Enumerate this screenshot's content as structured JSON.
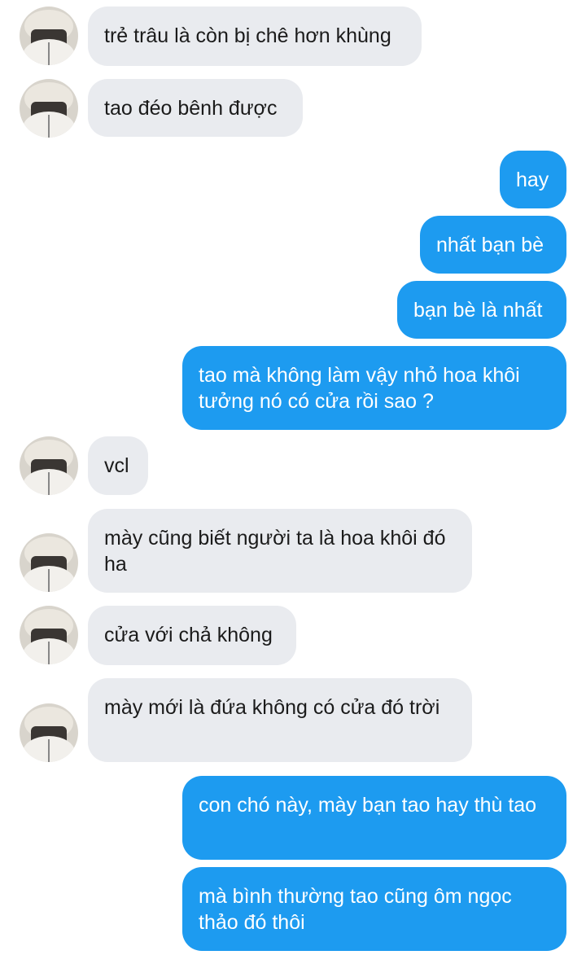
{
  "contact": {
    "avatar_icon": "contact-avatar"
  },
  "colors": {
    "incoming_bubble": "#e9ebef",
    "outgoing_bubble": "#1d9bf0",
    "incoming_text": "#1b1b1b",
    "outgoing_text": "#ffffff"
  },
  "messages": [
    {
      "direction": "incoming",
      "text": "trẻ trâu là còn bị chê hơn khùng"
    },
    {
      "direction": "incoming",
      "text": "tao đéo bênh được"
    },
    {
      "direction": "outgoing",
      "text": "hay"
    },
    {
      "direction": "outgoing",
      "text": "nhất bạn bè"
    },
    {
      "direction": "outgoing",
      "text": "bạn bè là nhất"
    },
    {
      "direction": "outgoing",
      "text": "tao mà không làm vậy nhỏ hoa khôi tưởng nó có cửa rồi sao ?"
    },
    {
      "direction": "incoming",
      "text": "vcl"
    },
    {
      "direction": "incoming",
      "text": "mày cũng biết người ta là hoa khôi đó ha"
    },
    {
      "direction": "incoming",
      "text": "cửa với chả không"
    },
    {
      "direction": "incoming",
      "text": "mày mới là đứa không có cửa đó trời"
    },
    {
      "direction": "outgoing",
      "text": "con chó này, mày bạn tao hay thù tao"
    },
    {
      "direction": "outgoing",
      "text": "mà bình thường tao cũng ôm ngọc thảo đó thôi"
    }
  ]
}
